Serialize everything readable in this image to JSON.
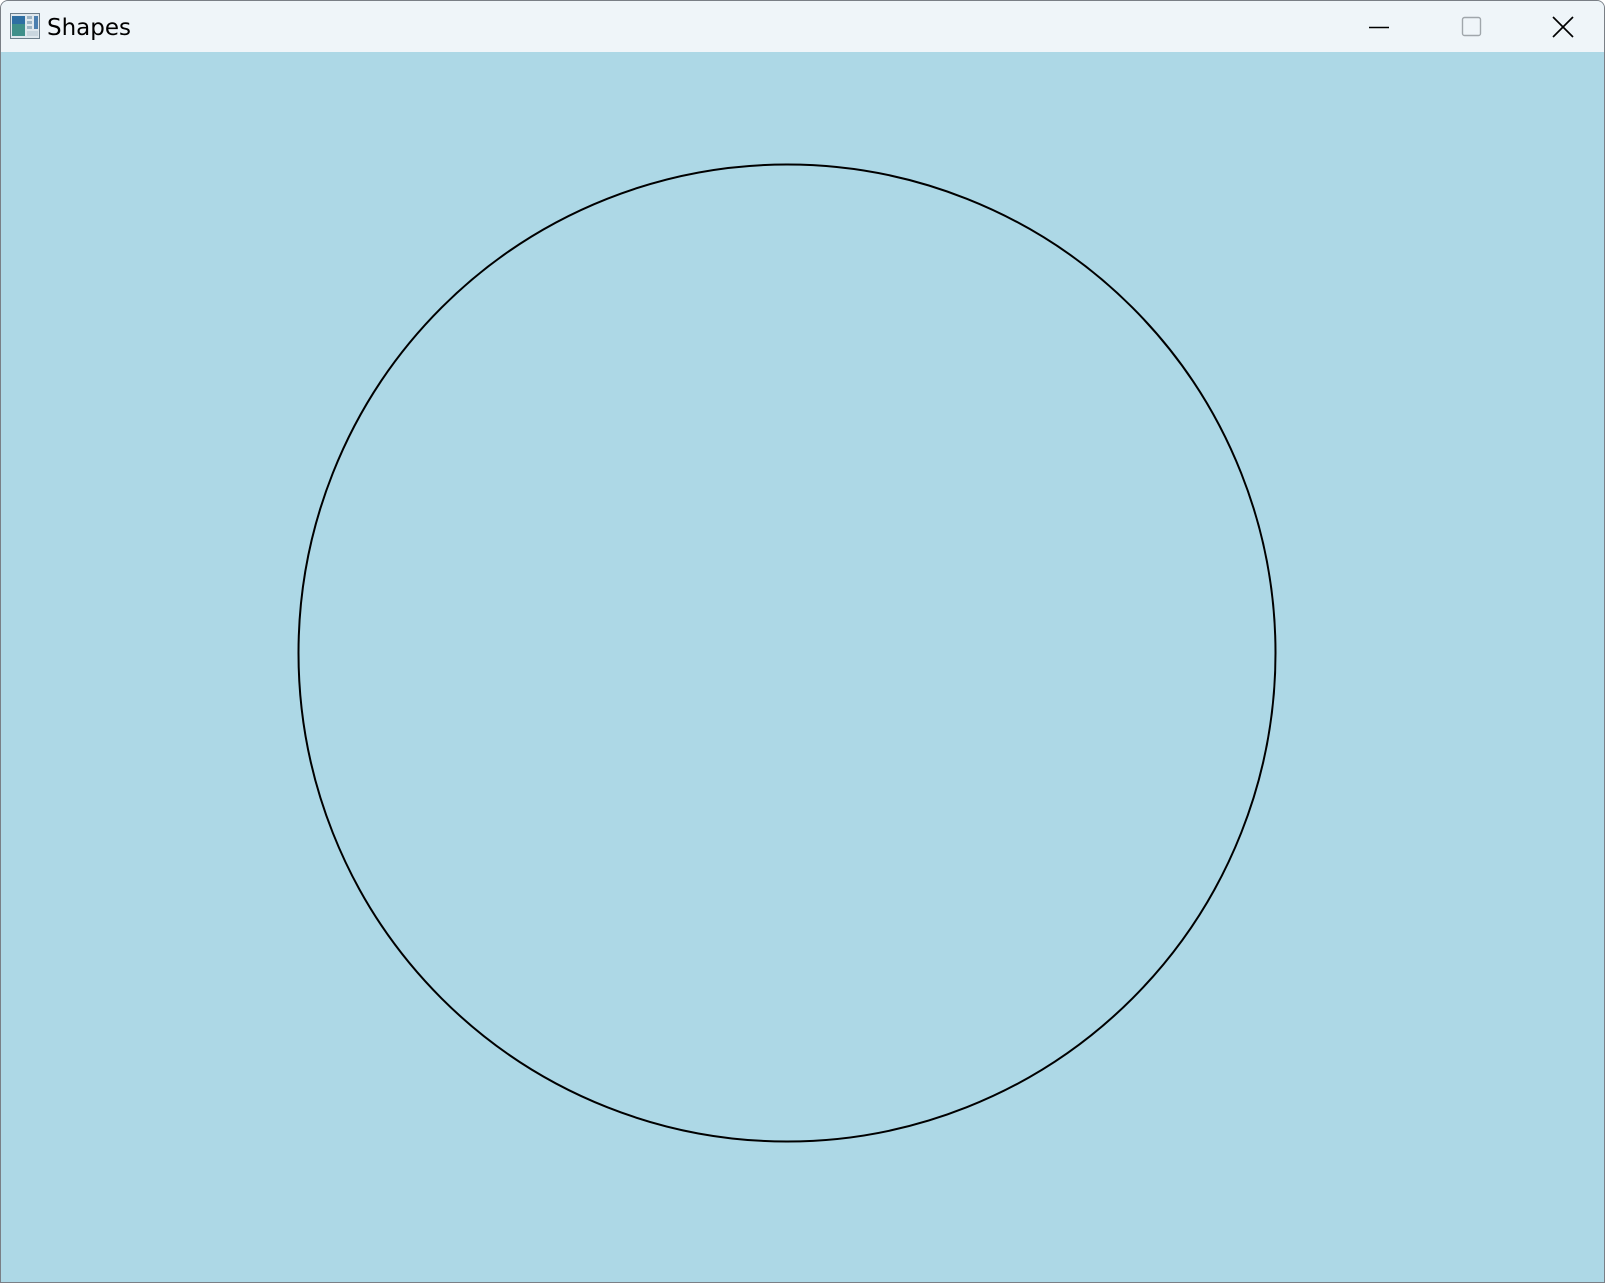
{
  "window": {
    "title": "Shapes",
    "icon": "app-window-icon"
  },
  "caption_buttons": {
    "minimize_icon": "minimize-icon",
    "maximize_icon": "maximize-icon",
    "close_icon": "close-icon"
  },
  "canvas": {
    "background_color": "#add8e6",
    "shapes": [
      {
        "type": "circle",
        "stroke_color": "#000000",
        "fill": "none"
      }
    ]
  },
  "colors": {
    "titlebar": "#eff5f9",
    "client_background": "#add8e6",
    "shape_stroke": "#000000"
  }
}
